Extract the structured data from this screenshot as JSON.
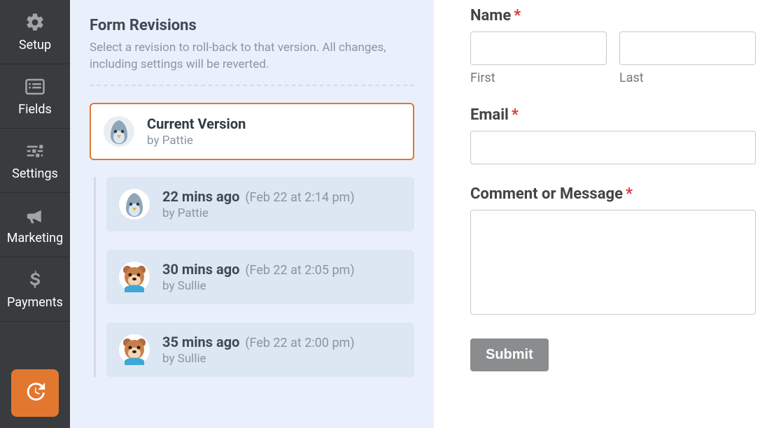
{
  "sidebar": {
    "items": [
      {
        "label": "Setup"
      },
      {
        "label": "Fields"
      },
      {
        "label": "Settings"
      },
      {
        "label": "Marketing"
      },
      {
        "label": "Payments"
      }
    ]
  },
  "revisions_panel": {
    "title": "Form Revisions",
    "description": "Select a revision to roll-back to that version. All changes, including settings will be reverted.",
    "current": {
      "title": "Current Version",
      "by_prefix": "by ",
      "author": "Pattie"
    },
    "items": [
      {
        "time": "22 mins ago",
        "date": "(Feb 22 at 2:14 pm)",
        "by_prefix": "by ",
        "author": "Pattie",
        "avatar_type": "bird"
      },
      {
        "time": "30 mins ago",
        "date": "(Feb 22 at 2:05 pm)",
        "by_prefix": "by ",
        "author": "Sullie",
        "avatar_type": "bear"
      },
      {
        "time": "35 mins ago",
        "date": "(Feb 22 at 2:00 pm)",
        "by_prefix": "by ",
        "author": "Sullie",
        "avatar_type": "bear"
      }
    ]
  },
  "form": {
    "name_label": "Name",
    "first_sub": "First",
    "last_sub": "Last",
    "email_label": "Email",
    "message_label": "Comment or Message",
    "submit_label": "Submit"
  },
  "colors": {
    "accent": "#e27730"
  }
}
